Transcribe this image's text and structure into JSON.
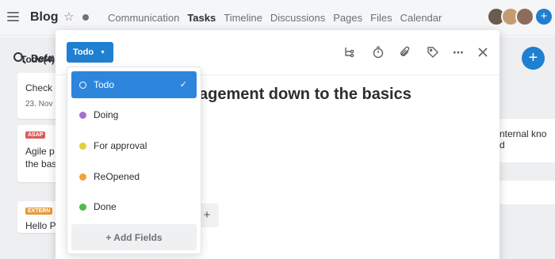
{
  "app": {
    "title": "Blog",
    "nav": [
      "Communication",
      "Tasks",
      "Timeline",
      "Discussions",
      "Pages",
      "Files",
      "Calendar"
    ],
    "active_nav": "Tasks"
  },
  "board": {
    "filter_label": "Defa",
    "column_title": "Todo(4)",
    "cards": [
      {
        "line1": "Check o",
        "line2": "23. Nov"
      },
      {
        "tag": "ASAP",
        "line1": "Agile p",
        "line2": "the bas"
      },
      {
        "tag": "EXTERN",
        "line1": "Hello P"
      }
    ],
    "right_card": {
      "line1": "nternal kno",
      "line2": "d"
    }
  },
  "task": {
    "status_label": "Todo",
    "title": "agement down to the basics",
    "add_field_symbol": "+"
  },
  "status_menu": {
    "items": [
      {
        "label": "Todo",
        "color": "#2d86dc",
        "selected": true
      },
      {
        "label": "Doing",
        "color": "#a46fd1",
        "selected": false
      },
      {
        "label": "For approval",
        "color": "#e2cf3c",
        "selected": false
      },
      {
        "label": "ReOpened",
        "color": "#f2a33a",
        "selected": false
      },
      {
        "label": "Done",
        "color": "#52b94a",
        "selected": false
      }
    ],
    "add_fields_label": "+ Add Fields"
  },
  "colors": {
    "accent": "#1f7fd1",
    "selected_bg": "#2d86dc"
  }
}
